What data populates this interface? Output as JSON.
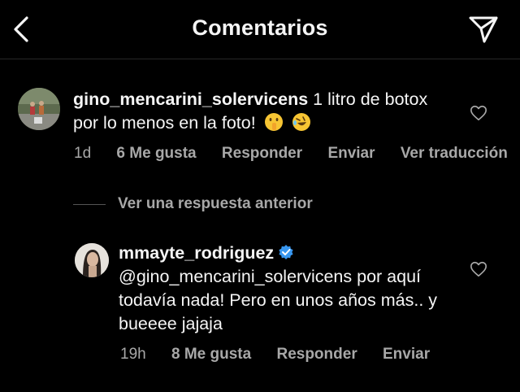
{
  "header": {
    "title": "Comentarios"
  },
  "comments": [
    {
      "username": "gino_mencarini_solervicens",
      "text": "1 litro de botox por lo menos en la foto!",
      "emojis": [
        "shushing-face",
        "rolling-on-floor-laughing"
      ],
      "time": "1d",
      "likes": "6 Me gusta",
      "reply": "Responder",
      "send": "Enviar",
      "translate": "Ver traducción"
    },
    {
      "username": "mmayte_rodriguez",
      "verified": true,
      "mention": "@gino_mencarini_solervicens",
      "text": "por aquí todavía nada! Pero en unos años más.. y bueeee jajaja",
      "time": "19h",
      "likes": "8 Me gusta",
      "reply": "Responder",
      "send": "Enviar"
    }
  ],
  "replies_toggle": "Ver una respuesta anterior",
  "colors": {
    "background": "#000000",
    "text": "#f5f5f5",
    "secondary": "#a8a8a8",
    "verified": "#3897f0"
  }
}
